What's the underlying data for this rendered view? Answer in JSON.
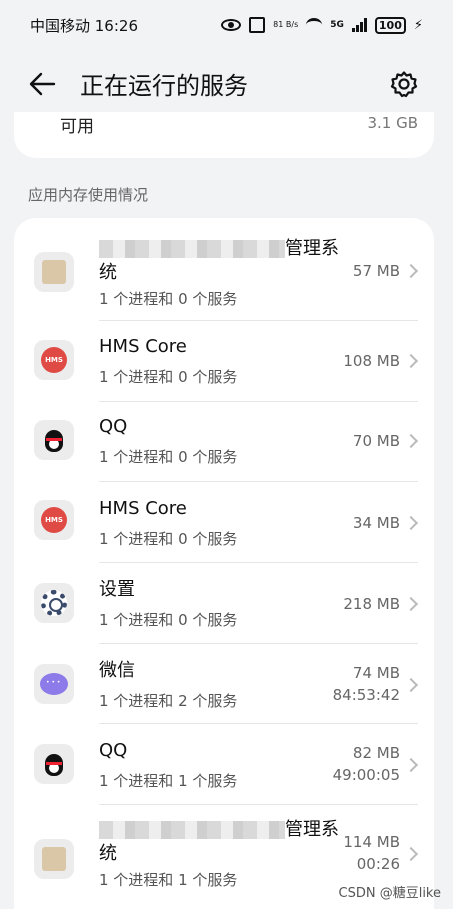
{
  "status_bar": {
    "carrier_time": "中国移动 16:26",
    "speed": "81 B/s",
    "network": "5G",
    "battery": "100"
  },
  "header": {
    "title": "正在运行的服务",
    "back_icon": "back-arrow-icon",
    "settings_icon": "gear-icon"
  },
  "memory": {
    "available_label": "可用",
    "available_value": "3.1 GB"
  },
  "section_label": "应用内存使用情况",
  "apps": [
    {
      "name_tail": "管理系",
      "name_line2": "统",
      "sub": "1 个进程和 0 个服务",
      "size": "57 MB",
      "time": "",
      "icon": "blurred-app-icon"
    },
    {
      "name": "HMS Core",
      "sub": "1 个进程和 0 个服务",
      "size": "108 MB",
      "time": "",
      "icon": "hms-core-icon"
    },
    {
      "name": "QQ",
      "sub": "1 个进程和 0 个服务",
      "size": "70 MB",
      "time": "",
      "icon": "qq-penguin-icon"
    },
    {
      "name": "HMS Core",
      "sub": "1 个进程和 0 个服务",
      "size": "34 MB",
      "time": "",
      "icon": "hms-core-icon"
    },
    {
      "name": "设置",
      "sub": "1 个进程和 0 个服务",
      "size": "218 MB",
      "time": "",
      "icon": "settings-gear-icon"
    },
    {
      "name": "微信",
      "sub": "1 个进程和 2 个服务",
      "size": "74 MB",
      "time": "84:53:42",
      "icon": "wechat-icon"
    },
    {
      "name": "QQ",
      "sub": "1 个进程和 1 个服务",
      "size": "82 MB",
      "time": "49:00:05",
      "icon": "qq-penguin-icon"
    },
    {
      "name_tail": "管理系",
      "name_line2": "统",
      "sub": "1 个进程和 1 个服务",
      "size": "114 MB",
      "time": "00:26",
      "icon": "blurred-app-icon"
    }
  ],
  "watermark": "CSDN @糖豆like"
}
